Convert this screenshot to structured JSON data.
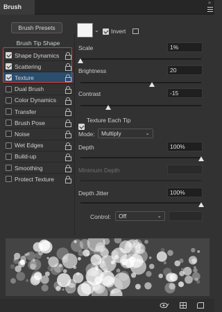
{
  "panel": {
    "tab_title": "Brush",
    "menu_dots": "»"
  },
  "sidebar": {
    "presets_button": "Brush Presets",
    "tip_shape_label": "Brush Tip Shape",
    "items": [
      {
        "label": "Shape Dynamics",
        "checked": true,
        "selected": false
      },
      {
        "label": "Scattering",
        "checked": true,
        "selected": false
      },
      {
        "label": "Texture",
        "checked": true,
        "selected": true
      },
      {
        "label": "Dual Brush",
        "checked": false,
        "selected": false
      },
      {
        "label": "Color Dynamics",
        "checked": false,
        "selected": false
      },
      {
        "label": "Transfer",
        "checked": false,
        "selected": false
      },
      {
        "label": "Brush Pose",
        "checked": false,
        "selected": false
      },
      {
        "label": "Noise",
        "checked": false,
        "selected": false
      },
      {
        "label": "Wet Edges",
        "checked": false,
        "selected": false
      },
      {
        "label": "Build-up",
        "checked": false,
        "selected": false
      },
      {
        "label": "Smoothing",
        "checked": false,
        "selected": false
      },
      {
        "label": "Protect Texture",
        "checked": false,
        "selected": false
      }
    ]
  },
  "texture": {
    "invert_label": "Invert",
    "invert_checked": true,
    "scale": {
      "label": "Scale",
      "value": "1%",
      "level": 0.0
    },
    "brightness": {
      "label": "Brightness",
      "value": "20",
      "level": 0.59
    },
    "contrast": {
      "label": "Contrast",
      "value": "-15",
      "level": 0.23
    },
    "texture_each_tip_label": "Texture Each Tip",
    "texture_each_tip_checked": true,
    "mode_label": "Mode:",
    "mode_value": "Multiply",
    "depth": {
      "label": "Depth",
      "value": "100%",
      "level": 1.0
    },
    "min_depth": {
      "label": "Minimum Depth",
      "value": ""
    },
    "depth_jitter": {
      "label": "Depth Jitter",
      "value": "100%",
      "level": 1.0
    },
    "control_label": "Control:",
    "control_value": "Off"
  },
  "colors": {
    "selected_bg": "#2b4d6e",
    "highlight": "#d23a3a"
  }
}
